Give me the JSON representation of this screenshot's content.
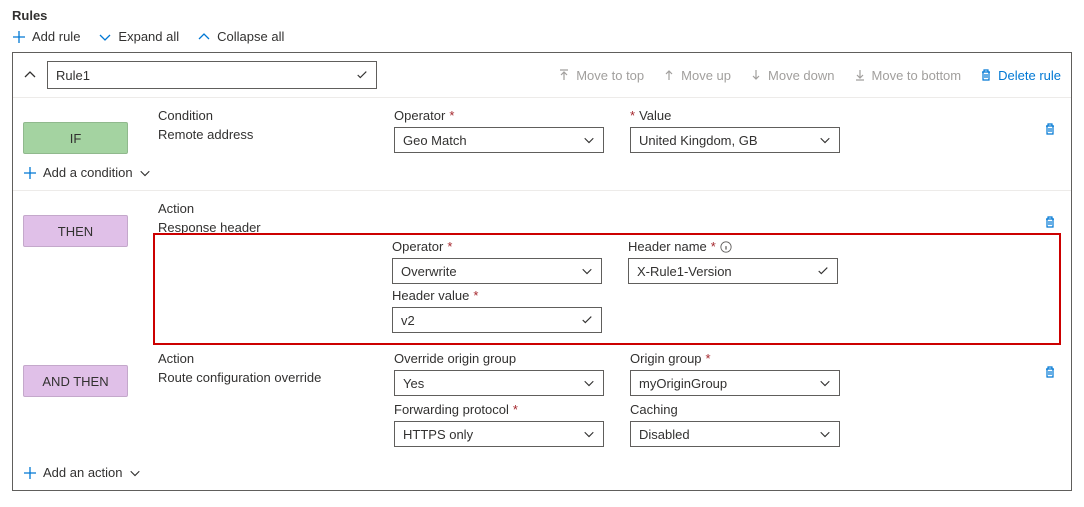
{
  "title": "Rules",
  "toolbar": {
    "add": "Add rule",
    "expand": "Expand all",
    "collapse": "Collapse all"
  },
  "rule": {
    "name": "Rule1",
    "moveTop": "Move to top",
    "moveUp": "Move up",
    "moveDown": "Move down",
    "moveBottom": "Move to bottom",
    "delete": "Delete rule"
  },
  "badges": {
    "if": "IF",
    "then": "THEN",
    "andthen": "AND THEN"
  },
  "condition": {
    "label": "Condition",
    "value": "Remote address",
    "operatorLabel": "Operator",
    "operatorValue": "Geo Match",
    "valueLabel": "Value",
    "valueValue": "United Kingdom, GB"
  },
  "addCondition": "Add a condition",
  "action1": {
    "label": "Action",
    "value": "Response header",
    "operatorLabel": "Operator",
    "operatorValue": "Overwrite",
    "headerNameLabel": "Header name",
    "headerNameValue": "X-Rule1-Version",
    "headerValueLabel": "Header value",
    "headerValueValue": "v2"
  },
  "action2": {
    "label": "Action",
    "value": "Route configuration override",
    "overrideLabel": "Override origin group",
    "overrideValue": "Yes",
    "originGroupLabel": "Origin group",
    "originGroupValue": "myOriginGroup",
    "protocolLabel": "Forwarding protocol",
    "protocolValue": "HTTPS only",
    "cachingLabel": "Caching",
    "cachingValue": "Disabled"
  },
  "addAction": "Add an action"
}
